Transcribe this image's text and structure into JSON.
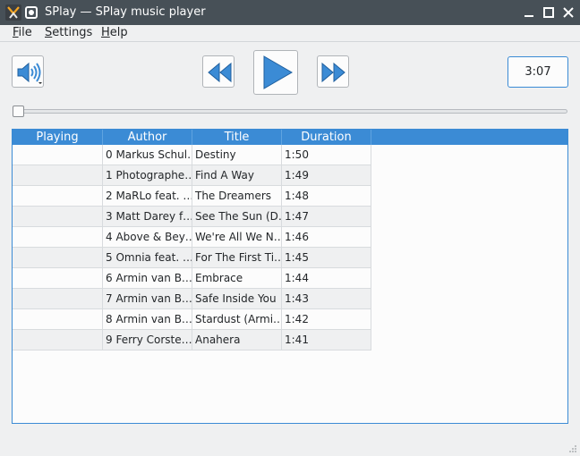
{
  "window": {
    "title": "SPlay — SPlay music player"
  },
  "menu": {
    "file": {
      "mnemonic": "F",
      "rest": "ile"
    },
    "settings": {
      "mnemonic": "S",
      "rest": "ettings"
    },
    "help": {
      "mnemonic": "H",
      "rest": "elp"
    }
  },
  "player": {
    "time": "3:07",
    "seek_position": 0.0
  },
  "icons": {
    "volume": "volume-icon",
    "rewind": "rewind-icon",
    "play": "play-icon",
    "forward": "fast-forward-icon"
  },
  "colors": {
    "accent": "#3b8bd5",
    "titlebar": "#475057",
    "background": "#eff0f1"
  },
  "playlist": {
    "columns": [
      "Playing",
      "Author",
      "Title",
      "Duration"
    ],
    "rows": [
      {
        "playing": "",
        "author": "0 Markus Schul…",
        "title": "Destiny",
        "duration": "1:50"
      },
      {
        "playing": "",
        "author": "1 Photographe…",
        "title": "Find A Way",
        "duration": "1:49"
      },
      {
        "playing": "",
        "author": "2 MaRLo feat. …",
        "title": "The Dreamers",
        "duration": "1:48"
      },
      {
        "playing": "",
        "author": "3 Matt Darey f…",
        "title": "See The Sun (D…",
        "duration": "1:47"
      },
      {
        "playing": "",
        "author": "4 Above & Bey…",
        "title": "We're All We N…",
        "duration": "1:46"
      },
      {
        "playing": "",
        "author": "5 Omnia feat. …",
        "title": "For The First Ti…",
        "duration": "1:45"
      },
      {
        "playing": "",
        "author": "6 Armin van B…",
        "title": "Embrace",
        "duration": "1:44"
      },
      {
        "playing": "",
        "author": "7 Armin van B…",
        "title": "Safe Inside You",
        "duration": "1:43"
      },
      {
        "playing": "",
        "author": "8 Armin van B…",
        "title": "Stardust (Armi…",
        "duration": "1:42"
      },
      {
        "playing": "",
        "author": "9 Ferry Corste…",
        "title": "Anahera",
        "duration": "1:41"
      }
    ]
  }
}
